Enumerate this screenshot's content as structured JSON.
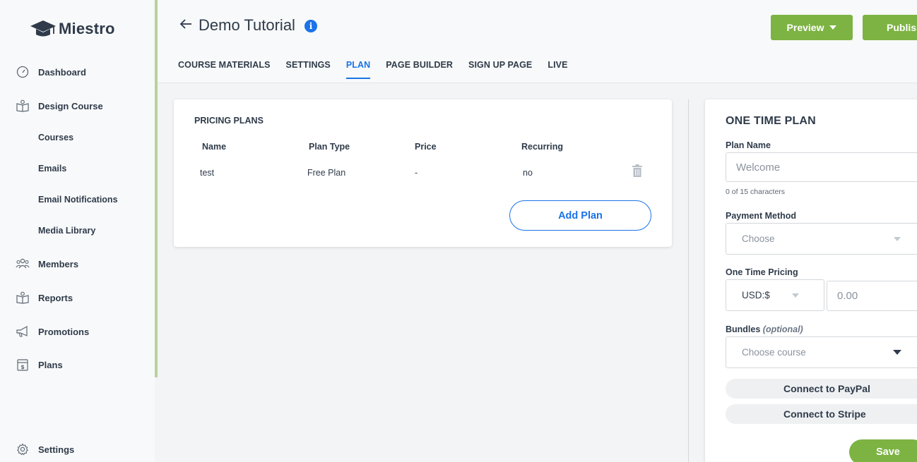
{
  "app": {
    "name": "Miestro"
  },
  "sidebar": {
    "items": [
      {
        "label": "Dashboard",
        "icon": "gauge-icon"
      },
      {
        "label": "Design Course",
        "icon": "book-icon"
      },
      {
        "label": "Courses"
      },
      {
        "label": "Emails"
      },
      {
        "label": "Email Notifications"
      },
      {
        "label": "Media Library"
      },
      {
        "label": "Members",
        "icon": "users-icon"
      },
      {
        "label": "Reports",
        "icon": "report-icon"
      },
      {
        "label": "Promotions",
        "icon": "megaphone-icon"
      },
      {
        "label": "Plans",
        "icon": "plans-icon"
      },
      {
        "label": "Settings",
        "icon": "gear-icon"
      }
    ]
  },
  "header": {
    "title": "Demo Tutorial",
    "info_glyph": "i",
    "preview_label": "Preview",
    "publish_label": "Publish",
    "tabs": [
      {
        "label": "COURSE MATERIALS",
        "active": false
      },
      {
        "label": "SETTINGS",
        "active": false
      },
      {
        "label": "PLAN",
        "active": true
      },
      {
        "label": "PAGE BUILDER",
        "active": false
      },
      {
        "label": "SIGN UP PAGE",
        "active": false
      },
      {
        "label": "LIVE",
        "active": false
      }
    ]
  },
  "pricing_plans": {
    "title": "PRICING PLANS",
    "columns": [
      "Name",
      "Plan Type",
      "Price",
      "Recurring"
    ],
    "rows": [
      {
        "name": "test",
        "plan_type": "Free Plan",
        "price": "-",
        "recurring": "no"
      }
    ],
    "add_label": "Add Plan"
  },
  "one_time_plan": {
    "title": "ONE TIME PLAN",
    "plan_name_label": "Plan Name",
    "plan_name_placeholder": "Welcome",
    "char_hint": "0 of 15 characters",
    "payment_method_label": "Payment Method",
    "payment_method_value": "Choose",
    "pricing_label": "One Time Pricing",
    "currency_value": "USD:$",
    "amount_placeholder": "0.00",
    "bundles_label": "Bundles",
    "bundles_optional": "(optional)",
    "bundles_value": "Choose course",
    "paypal_label": "Connect to PayPal",
    "stripe_label": "Connect to Stripe",
    "save_label": "Save"
  },
  "colors": {
    "accent_blue": "#1a73e8",
    "brand_green": "#7cb342",
    "text": "#2f3b4a"
  }
}
